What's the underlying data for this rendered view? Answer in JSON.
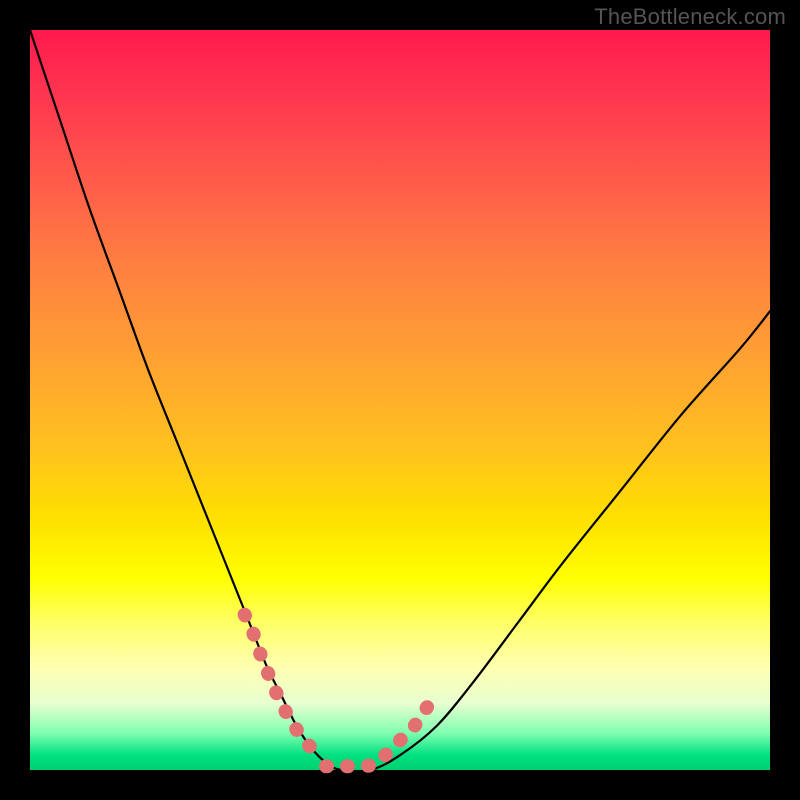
{
  "watermark": "TheBottleneck.com",
  "chart_data": {
    "type": "line",
    "title": "",
    "xlabel": "",
    "ylabel": "",
    "xlim": [
      0,
      100
    ],
    "ylim": [
      0,
      100
    ],
    "grid": false,
    "legend": false,
    "series": [
      {
        "name": "bottleneck-curve",
        "x": [
          0,
          4,
          8,
          12,
          16,
          20,
          24,
          28,
          30,
          32,
          34,
          36,
          38,
          40,
          42,
          46,
          50,
          55,
          60,
          66,
          72,
          80,
          88,
          96,
          100
        ],
        "y": [
          100,
          88,
          76,
          65,
          54,
          44,
          34,
          24,
          19,
          14,
          10,
          6,
          3,
          1,
          0,
          0,
          2,
          6,
          12,
          20,
          28,
          38,
          48,
          57,
          62
        ]
      },
      {
        "name": "highlight-left",
        "x": [
          29,
          30,
          31,
          33,
          35,
          37,
          39
        ],
        "y": [
          21,
          19,
          16,
          11,
          7,
          4,
          2
        ]
      },
      {
        "name": "highlight-bottom",
        "x": [
          40,
          42,
          44,
          46
        ],
        "y": [
          0.5,
          0.5,
          0.5,
          0.6
        ]
      },
      {
        "name": "highlight-right",
        "x": [
          48,
          50,
          52,
          54
        ],
        "y": [
          2,
          4,
          6,
          9
        ]
      }
    ],
    "background_gradient": {
      "top": "#ff1a4d",
      "mid": "#ffe000",
      "bottom": "#00d070"
    }
  }
}
